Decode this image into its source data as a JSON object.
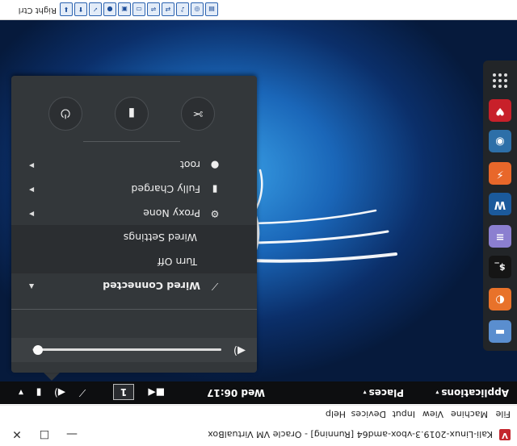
{
  "window": {
    "title": "Kali-Linux-2019.3-vbox-amd64 [Running] - Oracle VM VirtualBox",
    "minimize_glyph": "—",
    "restore_glyph": "☐",
    "close_glyph": "✕"
  },
  "menubar": [
    "File",
    "Machine",
    "View",
    "Input",
    "Devices",
    "Help"
  ],
  "top_panel": {
    "applications": "Applications",
    "places": "Places",
    "clock": "Wed 06:17",
    "workspace": "1",
    "caret": "▾"
  },
  "system_menu": {
    "volume": {
      "level_fraction": 0.97
    },
    "wired": {
      "label": "Wired Connected",
      "turn_off": "Turn Off",
      "settings": "Wired Settings"
    },
    "proxy": "Proxy None",
    "battery": "Fully Charged",
    "user": "root",
    "actions": {
      "settings_glyph": "✂",
      "lock_glyph": "▮",
      "power_glyph": "⏻"
    }
  },
  "dock": {
    "apps": [
      {
        "name": "app-grid"
      },
      {
        "name": "kali-tools",
        "glyph": "♥",
        "color": "#c8202a"
      },
      {
        "name": "eye-app",
        "glyph": "◉",
        "color": "#2d6fa8"
      },
      {
        "name": "burpsuite",
        "glyph": "⚡",
        "color": "#e8672a"
      },
      {
        "name": "wireshark",
        "glyph": "W",
        "color": "#1b5a9c"
      },
      {
        "name": "text-editor",
        "glyph": "≡",
        "color": "#8b7fd0"
      },
      {
        "name": "terminal",
        "glyph": "$_",
        "color": "#151515"
      },
      {
        "name": "firefox",
        "glyph": "◐",
        "color": "#e8722a"
      },
      {
        "name": "files",
        "glyph": "▬",
        "color": "#5a8ecf"
      }
    ]
  },
  "statusbar": {
    "host_key": "Right Ctrl",
    "icons": [
      "hdd",
      "optical",
      "audio",
      "network",
      "usb",
      "shared-folders",
      "display",
      "recording",
      "cpu",
      "mouse",
      "capture"
    ]
  }
}
